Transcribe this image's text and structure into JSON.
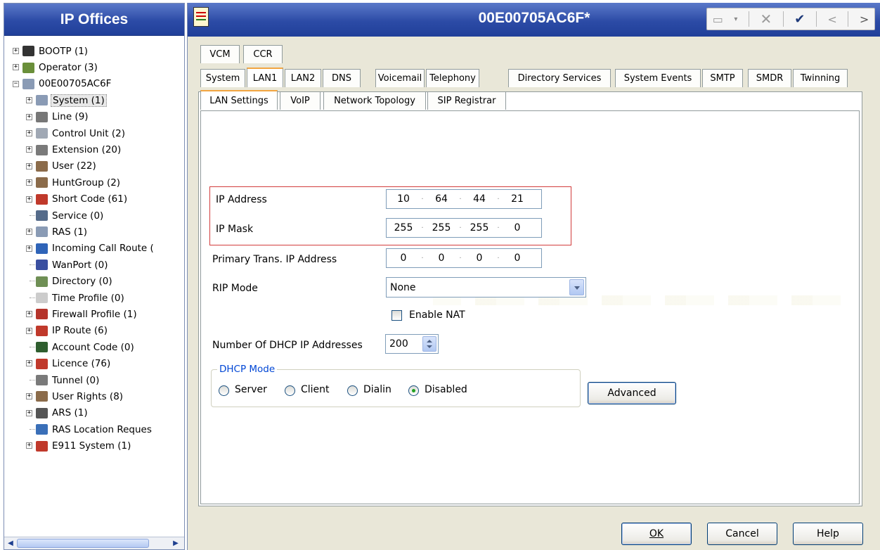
{
  "left_pane": {
    "title": "IP Offices",
    "tree": [
      {
        "label": "BOOTP (1)",
        "level": 0,
        "expander": "+",
        "icon": "bootp-icon",
        "color": "#333333"
      },
      {
        "label": "Operator (3)",
        "level": 0,
        "expander": "+",
        "icon": "operator-icon",
        "color": "#6a8f3a"
      },
      {
        "label": "00E00705AC6F",
        "level": 0,
        "expander": "-",
        "icon": "ip-office-unit-icon",
        "color": "#8a9bb5"
      },
      {
        "label": "System (1)",
        "level": 1,
        "expander": "+",
        "icon": "system-icon",
        "color": "#8a9bb5",
        "selected": true
      },
      {
        "label": "Line (9)",
        "level": 1,
        "expander": "+",
        "icon": "line-icon",
        "color": "#777777"
      },
      {
        "label": "Control Unit (2)",
        "level": 1,
        "expander": "+",
        "icon": "control-unit-icon",
        "color": "#a0a8b4"
      },
      {
        "label": "Extension (20)",
        "level": 1,
        "expander": "+",
        "icon": "extension-icon",
        "color": "#7a7a7a"
      },
      {
        "label": "User (22)",
        "level": 1,
        "expander": "+",
        "icon": "user-icon",
        "color": "#8b6b4a"
      },
      {
        "label": "HuntGroup (2)",
        "level": 1,
        "expander": "+",
        "icon": "huntgroup-icon",
        "color": "#8b6b4a"
      },
      {
        "label": "Short Code (61)",
        "level": 1,
        "expander": "+",
        "icon": "short-code-icon",
        "color": "#c0392b"
      },
      {
        "label": "Service (0)",
        "level": 1,
        "expander": "",
        "icon": "service-icon",
        "color": "#556b8a"
      },
      {
        "label": "RAS (1)",
        "level": 1,
        "expander": "+",
        "icon": "ras-icon",
        "color": "#8a9bb5"
      },
      {
        "label": "Incoming Call Route (",
        "level": 1,
        "expander": "+",
        "icon": "incoming-call-route-icon",
        "color": "#2f64b8"
      },
      {
        "label": "WanPort (0)",
        "level": 1,
        "expander": "",
        "icon": "wanport-icon",
        "color": "#3a4fa0"
      },
      {
        "label": "Directory (0)",
        "level": 1,
        "expander": "",
        "icon": "directory-icon",
        "color": "#6f8f55"
      },
      {
        "label": "Time Profile (0)",
        "level": 1,
        "expander": "",
        "icon": "time-profile-icon",
        "color": "#cccccc"
      },
      {
        "label": "Firewall Profile (1)",
        "level": 1,
        "expander": "+",
        "icon": "firewall-profile-icon",
        "color": "#b5342b"
      },
      {
        "label": "IP Route (6)",
        "level": 1,
        "expander": "+",
        "icon": "ip-route-icon",
        "color": "#c0392b"
      },
      {
        "label": "Account Code (0)",
        "level": 1,
        "expander": "",
        "icon": "account-code-icon",
        "color": "#2f5e2f"
      },
      {
        "label": "Licence (76)",
        "level": 1,
        "expander": "+",
        "icon": "licence-icon",
        "color": "#c0392b"
      },
      {
        "label": "Tunnel (0)",
        "level": 1,
        "expander": "",
        "icon": "tunnel-icon",
        "color": "#7a7a7a"
      },
      {
        "label": "User Rights (8)",
        "level": 1,
        "expander": "+",
        "icon": "user-rights-icon",
        "color": "#8b6b4a"
      },
      {
        "label": "ARS (1)",
        "level": 1,
        "expander": "+",
        "icon": "ars-icon",
        "color": "#555555"
      },
      {
        "label": "RAS Location Reques",
        "level": 1,
        "expander": "",
        "icon": "ras-location-request-icon",
        "color": "#3a6fb8"
      },
      {
        "label": "E911 System (1)",
        "level": 1,
        "expander": "+",
        "icon": "e911-system-icon",
        "color": "#c0392b"
      }
    ]
  },
  "header": {
    "title": "00E00705AC6F*",
    "toolbar_icons": [
      "new-config-icon",
      "dropdown-icon",
      "delete-icon",
      "validate-check-icon",
      "previous-icon",
      "next-icon"
    ]
  },
  "tabs": {
    "row1": [
      "VCM",
      "CCR"
    ],
    "row2": [
      "System",
      "LAN1",
      "LAN2",
      "DNS",
      "Voicemail",
      "Telephony",
      "Directory Services",
      "System Events",
      "SMTP",
      "SMDR",
      "Twinning"
    ],
    "active": "LAN1"
  },
  "subtabs": {
    "items": [
      "LAN Settings",
      "VoIP",
      "Network Topology",
      "SIP Registrar"
    ],
    "active": "LAN Settings"
  },
  "form": {
    "ip_address": {
      "label": "IP Address",
      "octets": [
        "10",
        "64",
        "44",
        "21"
      ]
    },
    "ip_mask": {
      "label": "IP Mask",
      "octets": [
        "255",
        "255",
        "255",
        "0"
      ]
    },
    "primary_trans": {
      "label": "Primary Trans. IP Address",
      "octets": [
        "0",
        "0",
        "0",
        "0"
      ]
    },
    "rip_mode": {
      "label": "RIP Mode",
      "value": "None"
    },
    "enable_nat": {
      "label": "Enable NAT",
      "checked": false
    },
    "dhcp_count": {
      "label": "Number Of DHCP IP Addresses",
      "value": "200"
    },
    "dhcp_mode": {
      "label": "DHCP Mode",
      "options": [
        "Server",
        "Client",
        "Dialin",
        "Disabled"
      ],
      "selected": "Disabled"
    },
    "advanced_label": "Advanced"
  },
  "footer": {
    "ok": "OK",
    "cancel": "Cancel",
    "help": "Help"
  }
}
